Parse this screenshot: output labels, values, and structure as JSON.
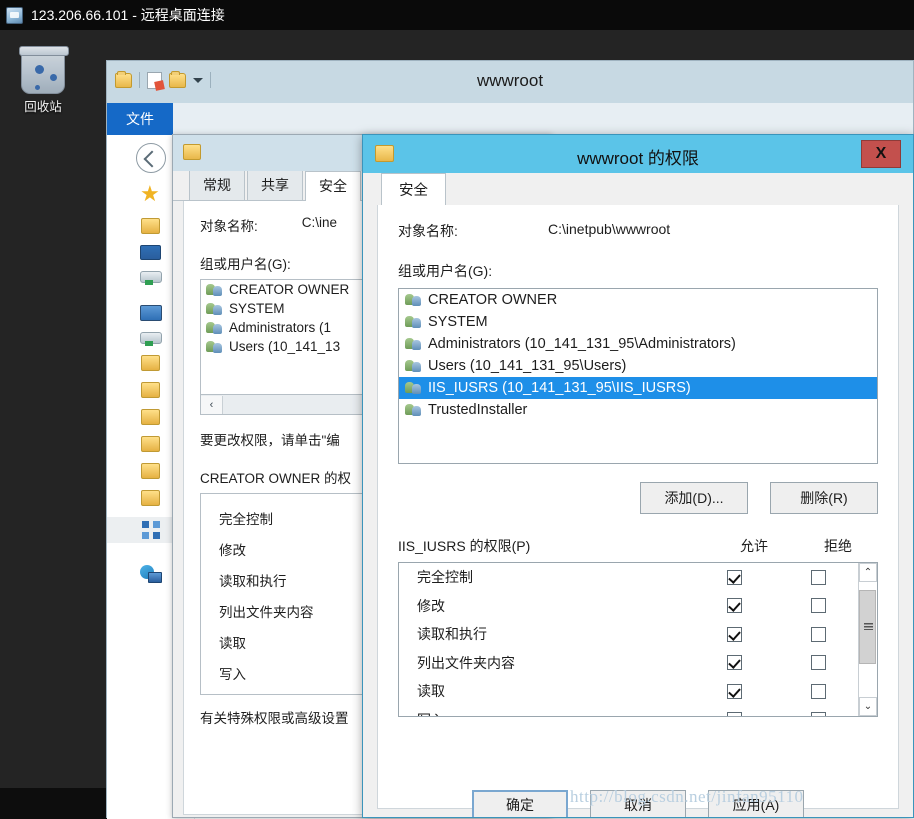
{
  "rdp": {
    "title": "123.206.66.101 - 远程桌面连接",
    "icon": "remote-desktop-icon"
  },
  "desktop": {
    "recycle_bin_label": "回收站"
  },
  "explorer": {
    "title": "wwwroot",
    "quick_access": [
      "folder-icon",
      "new-folder-icon",
      "properties-icon",
      "customize-caret-icon"
    ],
    "ribbon_tabs": [
      {
        "label": "文件"
      }
    ],
    "nav_icons": [
      "back-arrow-icon",
      "favorites-star-icon",
      "folder-icon",
      "desktop-icon",
      "downloads-icon",
      "computer-icon",
      "local-disk-icon",
      "folder-icon",
      "folder-icon",
      "folder-icon",
      "folder-icon",
      "folder-icon",
      "folder-icon",
      "apps-icon",
      "network-icon"
    ]
  },
  "props_dialog": {
    "title_icon": "folder-icon",
    "tabs": [
      {
        "label": "常规",
        "active": false
      },
      {
        "label": "共享",
        "active": false
      },
      {
        "label": "安全",
        "active": true
      }
    ],
    "object_name_label": "对象名称:",
    "object_name_value": "C:\\ine",
    "group_label": "组或用户名(G):",
    "users": [
      "CREATOR OWNER",
      "SYSTEM",
      "Administrators (1",
      "Users (10_141_13"
    ],
    "hscroll_left": "‹",
    "edit_note": "要更改权限，请单击\"编",
    "perm_title": "CREATOR OWNER 的权",
    "permissions": [
      "完全控制",
      "修改",
      "读取和执行",
      "列出文件夹内容",
      "读取",
      "写入"
    ],
    "advanced_note": "有关特殊权限或高级设置"
  },
  "perm_dialog": {
    "title": "wwwroot 的权限",
    "title_icon": "folder-icon",
    "close_label": "X",
    "tabs": [
      {
        "label": "安全",
        "active": true
      }
    ],
    "object_name_label": "对象名称:",
    "object_name_value": "C:\\inetpub\\wwwroot",
    "group_label": "组或用户名(G):",
    "users": [
      {
        "name": "CREATOR OWNER",
        "selected": false
      },
      {
        "name": "SYSTEM",
        "selected": false
      },
      {
        "name": "Administrators (10_141_131_95\\Administrators)",
        "selected": false
      },
      {
        "name": "Users (10_141_131_95\\Users)",
        "selected": false
      },
      {
        "name": "IIS_IUSRS (10_141_131_95\\IIS_IUSRS)",
        "selected": true
      },
      {
        "name": "TrustedInstaller",
        "selected": false
      }
    ],
    "add_button": "添加(D)...",
    "remove_button": "删除(R)",
    "perm_table_title": "IIS_IUSRS 的权限(P)",
    "col_allow": "允许",
    "col_deny": "拒绝",
    "perm_rows": [
      {
        "name": "完全控制",
        "allow": true,
        "deny": false
      },
      {
        "name": "修改",
        "allow": true,
        "deny": false
      },
      {
        "name": "读取和执行",
        "allow": true,
        "deny": false
      },
      {
        "name": "列出文件夹内容",
        "allow": true,
        "deny": false
      },
      {
        "name": "读取",
        "allow": true,
        "deny": false
      },
      {
        "name": "写入",
        "allow": true,
        "deny": false
      }
    ],
    "scroll_up": "⌃",
    "scroll_down": "⌄",
    "footer_buttons": [
      {
        "label": "确定",
        "primary": true
      },
      {
        "label": "取消",
        "primary": false
      },
      {
        "label": "应用(A)",
        "primary": false
      }
    ]
  },
  "watermark": "http://blog.csdn.net/jinfan95110",
  "colors": {
    "rdp_titlebar": "#0a0a0a",
    "desktop": "#242424",
    "perm_titlebar": "#5bc4e8",
    "close_button": "#c3504d",
    "selection": "#1e8fe8",
    "ribbon_tab_active": "#1569c7"
  }
}
